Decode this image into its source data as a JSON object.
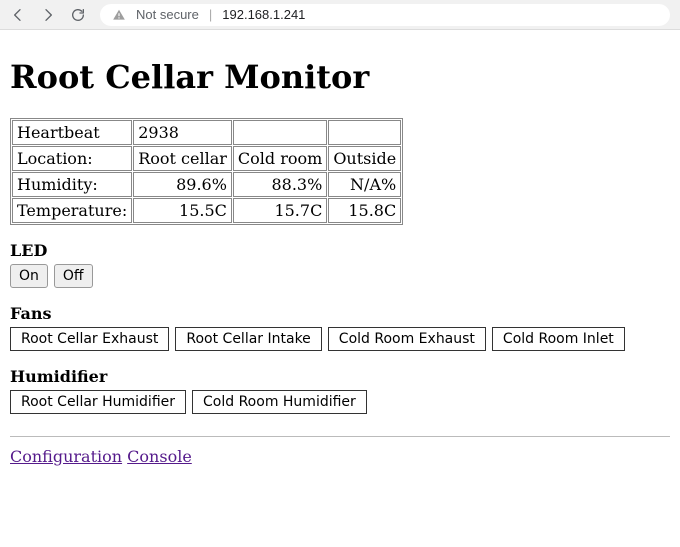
{
  "browser": {
    "not_secure": "Not secure",
    "url": "192.168.1.241"
  },
  "page": {
    "title": "Root Cellar Monitor"
  },
  "table": {
    "rows": {
      "heartbeat": {
        "label": "Heartbeat",
        "value": "2938"
      },
      "location": {
        "label": "Location:",
        "c1": "Root cellar",
        "c2": "Cold room",
        "c3": "Outside"
      },
      "humidity": {
        "label": "Humidity:",
        "c1": "89.6%",
        "c2": "88.3%",
        "c3": "N/A%"
      },
      "temperature": {
        "label": "Temperature:",
        "c1": "15.5C",
        "c2": "15.7C",
        "c3": "15.8C"
      }
    }
  },
  "sections": {
    "led": {
      "label": "LED",
      "on": "On",
      "off": "Off"
    },
    "fans": {
      "label": "Fans",
      "b1": "Root Cellar Exhaust",
      "b2": "Root Cellar Intake",
      "b3": "Cold Room Exhaust",
      "b4": "Cold Room Inlet"
    },
    "humidifier": {
      "label": "Humidifier",
      "b1": "Root Cellar Humidifier",
      "b2": "Cold Room Humidifier"
    }
  },
  "footer": {
    "link1": "Configuration",
    "link2": "Console"
  }
}
